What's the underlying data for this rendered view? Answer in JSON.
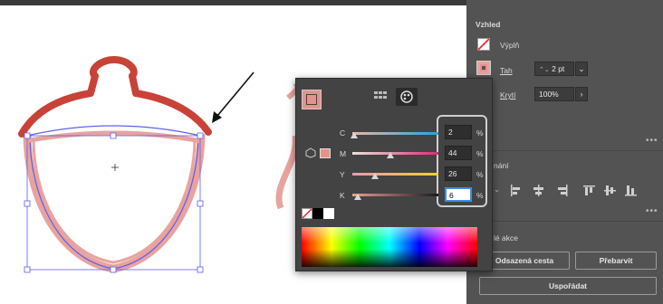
{
  "properties_panel": {
    "section_title": "Vzhled",
    "fill_label": "Výplň",
    "stroke_label": "Tah",
    "stroke_weight": "2 pt",
    "opacity_label": "Krytí",
    "opacity_value": "100%",
    "more_dots": "•••",
    "align_label": "nání",
    "quick_actions_label": "lé akce",
    "offset_path_button": "Odsazená cesta",
    "recolor_button": "Přebarvit",
    "arrange_button": "Uspořádat"
  },
  "color_panel": {
    "channels": [
      {
        "label": "C",
        "value": "2",
        "fraction": 0.02
      },
      {
        "label": "M",
        "value": "44",
        "fraction": 0.44
      },
      {
        "label": "Y",
        "value": "26",
        "fraction": 0.26
      },
      {
        "label": "K",
        "value": "6",
        "fraction": 0.06
      }
    ],
    "percent_sign": "%",
    "current_color": "#e8918b"
  },
  "colors": {
    "acorn_cap": "#c94238",
    "acorn_outline": "#e8a39e",
    "selection": "#5e5ef0",
    "panel_bg": "#535353"
  }
}
